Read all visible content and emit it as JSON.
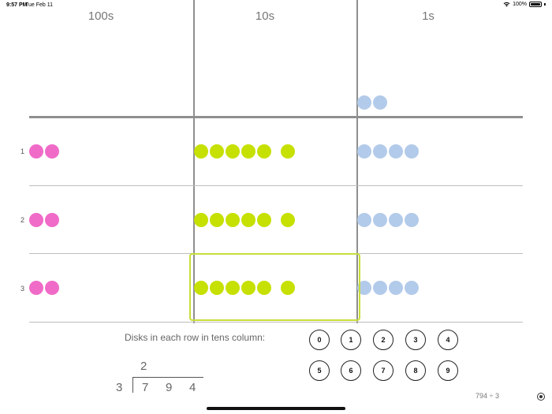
{
  "status_bar": {
    "time": "9:57 PM",
    "date": "Tue Feb 11",
    "battery": "100%",
    "icons": [
      "wifi-icon",
      "battery-icon"
    ]
  },
  "columns": [
    {
      "label": "100s"
    },
    {
      "label": "10s"
    },
    {
      "label": "1s"
    }
  ],
  "rows": [
    {
      "label": "1",
      "hundreds": 2,
      "tens": 6,
      "ones": 4
    },
    {
      "label": "2",
      "hundreds": 2,
      "tens": 6,
      "ones": 4
    },
    {
      "label": "3",
      "hundreds": 2,
      "tens": 6,
      "ones": 4
    }
  ],
  "remainder_area": {
    "ones": 2
  },
  "highlighted": {
    "row": 3,
    "column": "10s"
  },
  "colors": {
    "hundreds": "#f06bc8",
    "tens": "#c6e000",
    "ones": "#b3cbea",
    "highlight": "#c9dd3a"
  },
  "prompt": "Disks in each row in tens column:",
  "keypad": [
    "0",
    "1",
    "2",
    "3",
    "4",
    "5",
    "6",
    "7",
    "8",
    "9"
  ],
  "long_division": {
    "quotient": "2",
    "divisor": "3",
    "dividend_digits": [
      "7",
      "9",
      "4"
    ]
  },
  "problem_label": "794 ÷ 3",
  "record_icon": "record-icon"
}
